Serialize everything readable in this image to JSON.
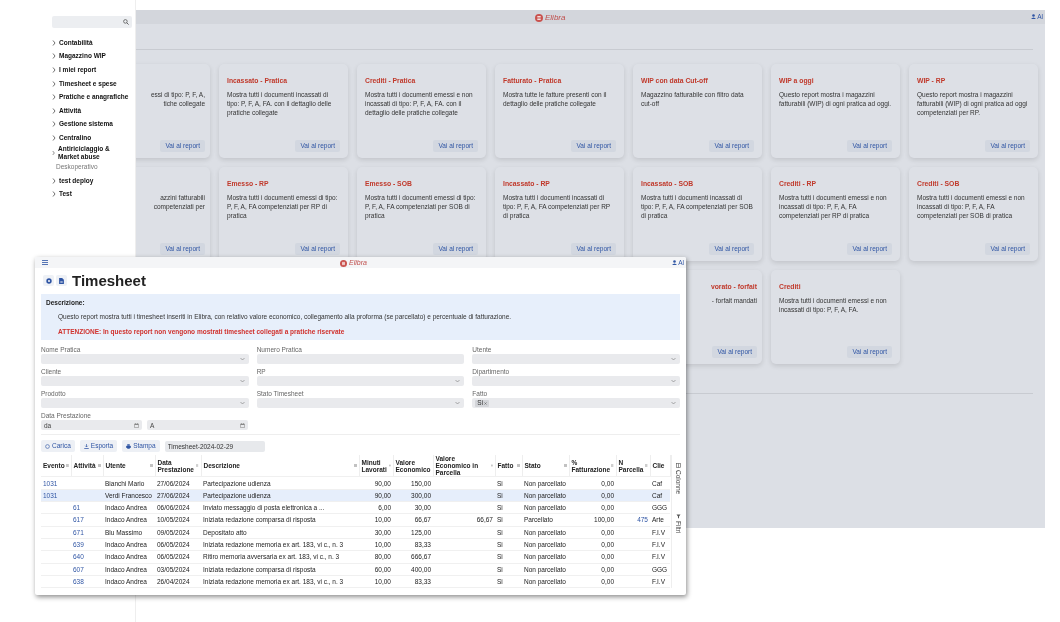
{
  "background_window": {
    "logo": "Elibra",
    "user": "Al",
    "report_cards": [
      [
        {
          "kind": "partial",
          "lines": [
            "essi di tipo: P, F, A,",
            "tiche collegate"
          ],
          "button": "Vai al report"
        },
        {
          "kind": "full",
          "title": "Incassato - Pratica",
          "description": "Mostra tutti i documenti incassati di tipo: P, F, A, FA. con il dettaglio delle pratiche collegate",
          "button": "Vai al report"
        },
        {
          "kind": "full",
          "title": "Crediti - Pratica",
          "description": "Mostra tutti i documenti emessi e non incassati di tipo: P, F, A, FA. con il dettaglio delle pratiche collegate",
          "button": "Vai al report"
        },
        {
          "kind": "full",
          "title": "Fatturato - Pratica",
          "description": "Mostra tutte le fatture presenti con il dettaglio delle pratiche collegate",
          "button": "Vai al report"
        },
        {
          "kind": "full",
          "title": "WIP con data Cut-off",
          "description": "Magazzino fatturabile con filtro data cut-off",
          "button": "Vai al report"
        },
        {
          "kind": "full",
          "title": "WIP a oggi",
          "description": "Questo report mostra i magazzini fatturabili (WIP) di ogni pratica ad oggi.",
          "button": "Vai al report"
        },
        {
          "kind": "full",
          "title": "WIP - RP",
          "description": "Questo report mostra i magazzini fatturabili (WIP) di ogni pratica ad oggi competenziati per RP.",
          "button": "Vai al report"
        }
      ],
      [
        {
          "kind": "partial",
          "lines": [
            "azzini fatturabili",
            "competenziati per"
          ],
          "button": "Vai al report"
        },
        {
          "kind": "full",
          "title": "Emesso - RP",
          "description": "Mostra tutti i documenti emessi di tipo: P, F, A, FA competenziati per RP di pratica",
          "button": "Vai al report"
        },
        {
          "kind": "full",
          "title": "Emesso - SOB",
          "description": "Mostra tutti i documenti emessi di tipo: P, F, A, FA competenziati per SOB di pratica",
          "button": "Vai al report"
        },
        {
          "kind": "full",
          "title": "Incassato - RP",
          "description": "Mostra tutti i documenti incassati di tipo: P, F, A, FA competenziati per RP di pratica",
          "button": "Vai al report"
        },
        {
          "kind": "full",
          "title": "Incassato - SOB",
          "description": "Mostra tutti i documenti incassati di tipo: P, F, A, FA competenziati per SOB di pratica",
          "button": "Vai al report"
        },
        {
          "kind": "full",
          "title": "Crediti - RP",
          "description": "Mostra tutti i documenti emessi e non incassati di tipo: P, F, A, FA competenziati per RP di pratica",
          "button": "Vai al report"
        },
        {
          "kind": "full",
          "title": "Crediti - SOB",
          "description": "Mostra tutti i documenti emessi e non incassati di tipo: P, F, A, FA competenziati per SOB di pratica",
          "button": "Vai al report"
        }
      ],
      [
        {
          "kind": "partial",
          "title": "vorato - forfait",
          "lines": [
            "- forfait mandati"
          ],
          "button": "Vai al report"
        },
        {
          "kind": "full",
          "title": "Crediti",
          "description": "Mostra tutti i documenti emessi e non incassati di tipo: P, F, A, FA.",
          "button": "Vai al report"
        }
      ]
    ]
  },
  "sidebar": {
    "items": [
      {
        "label": "Contabilità",
        "kind": "group",
        "expanded": false
      },
      {
        "label": "Magazzino WIP",
        "kind": "group",
        "expanded": false
      },
      {
        "label": "I miei report",
        "kind": "group",
        "expanded": false
      },
      {
        "label": "Timesheet e spese",
        "kind": "group",
        "expanded": false
      },
      {
        "label": "Pratiche e anagrafiche",
        "kind": "group",
        "expanded": false
      },
      {
        "label": "Attività",
        "kind": "group",
        "expanded": false
      },
      {
        "label": "Gestione sistema",
        "kind": "group",
        "expanded": false
      },
      {
        "label": "Centralino",
        "kind": "group",
        "expanded": false
      },
      {
        "label": "Antiriciclaggio & Market abuse",
        "kind": "group",
        "expanded": false
      },
      {
        "label": "Deskoperativo",
        "kind": "link"
      },
      {
        "label": "test deploy",
        "kind": "group",
        "expanded": false
      },
      {
        "label": "Test",
        "kind": "group",
        "expanded": false
      }
    ]
  },
  "timesheet_window": {
    "logo": "Elibra",
    "user": "Al",
    "title": "Timesheet",
    "description": {
      "heading": "Descrizione:",
      "text": "Questo report mostra tutti i timesheet inseriti in Elibra, con relativo valore economico, collegamento alla proforma (se parcellato) e percentuale di fatturazione.",
      "warning": "ATTENZIONE: In questo report non vengono mostrati timesheet collegati a pratiche riservate"
    },
    "filters": [
      {
        "label": "Nome Pratica",
        "kind": "select"
      },
      {
        "label": "Numero Pratica",
        "kind": "input"
      },
      {
        "label": "Utente",
        "kind": "select"
      },
      {
        "label": "Cliente",
        "kind": "select"
      },
      {
        "label": "RP",
        "kind": "select"
      },
      {
        "label": "Dipartimento",
        "kind": "select"
      },
      {
        "label": "Prodotto",
        "kind": "select"
      },
      {
        "label": "Stato Timesheet",
        "kind": "select"
      },
      {
        "label": "Fatto",
        "kind": "select",
        "chips": [
          "Si"
        ]
      }
    ],
    "date_filter": {
      "label": "Data Prestazione",
      "from_placeholder": "da",
      "to_placeholder": "A"
    },
    "actions": [
      {
        "label": "Carica",
        "kind": "load"
      },
      {
        "label": "Esporta",
        "kind": "export"
      },
      {
        "label": "Stampa",
        "kind": "print"
      }
    ],
    "file_name": "Timesheet-2024-02-29",
    "table": {
      "columns": [
        {
          "label": "Evento",
          "kind": "link"
        },
        {
          "label": "Attività",
          "kind": "link"
        },
        {
          "label": "Utente",
          "kind": "text"
        },
        {
          "label": "Data Prestazione",
          "kind": "text"
        },
        {
          "label": "Descrizione",
          "kind": "text"
        },
        {
          "label": "Minuti Lavorati",
          "kind": "number"
        },
        {
          "label": "Valore Economico",
          "kind": "number"
        },
        {
          "label": "Valore Economico in Parcella",
          "kind": "number"
        },
        {
          "label": "Fatto",
          "kind": "text"
        },
        {
          "label": "Stato",
          "kind": "text"
        },
        {
          "label": "% Fatturazione",
          "kind": "number"
        },
        {
          "label": "N Parcella",
          "kind": "number-link"
        },
        {
          "label": "Clie",
          "kind": "text"
        }
      ],
      "rows": [
        {
          "selected": false,
          "cells": [
            "1031",
            "",
            "Bianchi Mario",
            "27/06/2024",
            "Partecipazione udienza",
            "90,00",
            "150,00",
            "",
            "Si",
            "Non parcellato",
            "0,00",
            "",
            "Caf"
          ]
        },
        {
          "selected": true,
          "cells": [
            "1031",
            "",
            "Verdi Francesco",
            "27/06/2024",
            "Partecipazione udienza",
            "90,00",
            "300,00",
            "",
            "Si",
            "Non parcellato",
            "0,00",
            "",
            "Caf"
          ]
        },
        {
          "selected": false,
          "cells": [
            "",
            "61",
            "Indaco Andrea",
            "06/06/2024",
            "Inviato messaggio di posta elettronica a ...",
            "6,00",
            "30,00",
            "",
            "Si",
            "Non parcellato",
            "0,00",
            "",
            "GGG"
          ]
        },
        {
          "selected": false,
          "cells": [
            "",
            "617",
            "Indaco Andrea",
            "10/05/2024",
            "Iniziata redazione comparsa di risposta",
            "10,00",
            "66,67",
            "66,67",
            "Si",
            "Parcellato",
            "100,00",
            "475",
            "Arte"
          ]
        },
        {
          "selected": false,
          "cells": [
            "",
            "671",
            "Blu Massimo",
            "09/05/2024",
            "Depositato atto",
            "30,00",
            "125,00",
            "",
            "Si",
            "Non parcellato",
            "0,00",
            "",
            "F.I.V"
          ]
        },
        {
          "selected": false,
          "cells": [
            "",
            "639",
            "Indaco Andrea",
            "06/05/2024",
            "Iniziata redazione memoria ex art. 183, vi c., n. 3",
            "10,00",
            "83,33",
            "",
            "Si",
            "Non parcellato",
            "0,00",
            "",
            "F.I.V"
          ]
        },
        {
          "selected": false,
          "cells": [
            "",
            "640",
            "Indaco Andrea",
            "06/05/2024",
            "Ritiro memoria avversaria ex art. 183, vi c., n. 3",
            "80,00",
            "666,67",
            "",
            "Si",
            "Non parcellato",
            "0,00",
            "",
            "F.I.V"
          ]
        },
        {
          "selected": false,
          "cells": [
            "",
            "607",
            "Indaco Andrea",
            "03/05/2024",
            "Iniziata redazione comparsa di risposta",
            "60,00",
            "400,00",
            "",
            "Si",
            "Non parcellato",
            "0,00",
            "",
            "GGG"
          ]
        },
        {
          "selected": false,
          "cells": [
            "",
            "638",
            "Indaco Andrea",
            "26/04/2024",
            "Iniziata redazione memoria ex art. 183, vi c., n. 3",
            "10,00",
            "83,33",
            "",
            "Si",
            "Non parcellato",
            "0,00",
            "",
            "F.I.V"
          ]
        }
      ]
    },
    "side_panel": [
      {
        "label": "Colonne",
        "kind": "columns"
      },
      {
        "label": "Filtri",
        "kind": "filters"
      }
    ]
  }
}
